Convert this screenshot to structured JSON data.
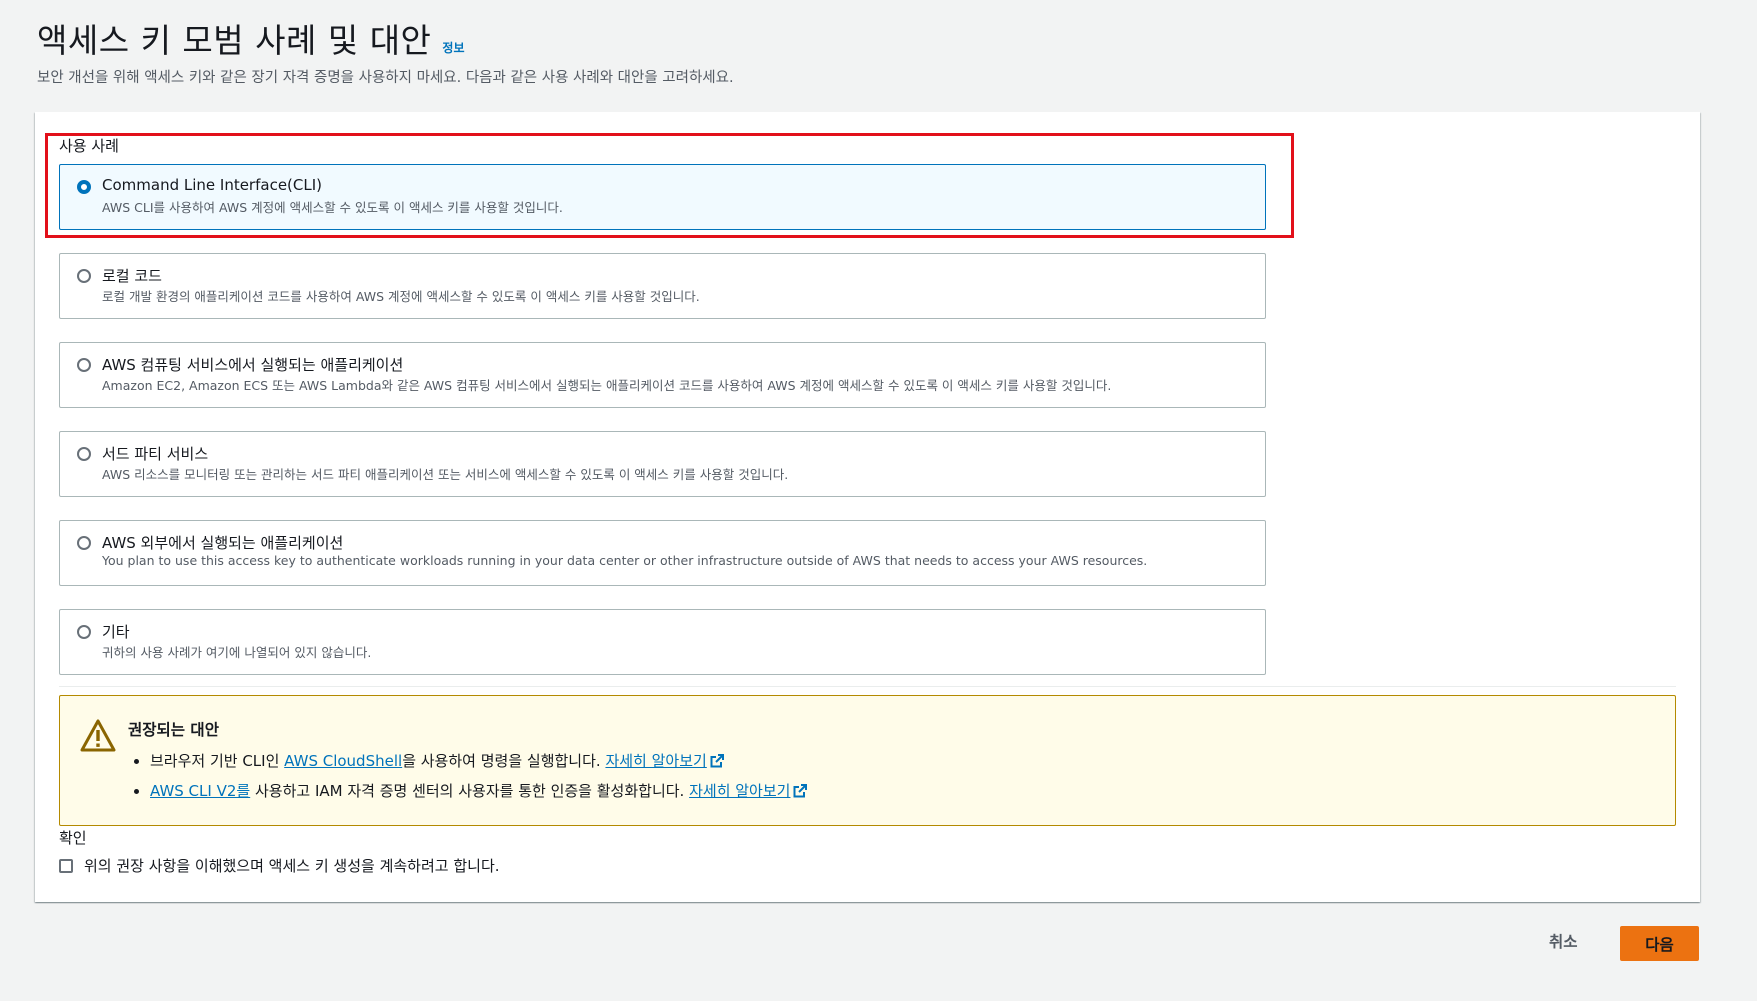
{
  "header": {
    "title": "액세스 키 모범 사례 및 대안",
    "info_link": "정보",
    "description": "보안 개선을 위해 액세스 키와 같은 장기 자격 증명을 사용하지 마세요. 다음과 같은 사용 사례와 대안을 고려하세요."
  },
  "use_case": {
    "label": "사용 사례",
    "selected_index": 0,
    "options": [
      {
        "title": "Command Line Interface(CLI)",
        "description": "AWS CLI를 사용하여 AWS 계정에 액세스할 수 있도록 이 액세스 키를 사용할 것입니다."
      },
      {
        "title": "로컬 코드",
        "description": "로컬 개발 환경의 애플리케이션 코드를 사용하여 AWS 계정에 액세스할 수 있도록 이 액세스 키를 사용할 것입니다."
      },
      {
        "title": "AWS 컴퓨팅 서비스에서 실행되는 애플리케이션",
        "description": "Amazon EC2, Amazon ECS 또는 AWS Lambda와 같은 AWS 컴퓨팅 서비스에서 실행되는 애플리케이션 코드를 사용하여 AWS 계정에 액세스할 수 있도록 이 액세스 키를 사용할 것입니다."
      },
      {
        "title": "서드 파티 서비스",
        "description": "AWS 리소스를 모니터링 또는 관리하는 서드 파티 애플리케이션 또는 서비스에 액세스할 수 있도록 이 액세스 키를 사용할 것입니다."
      },
      {
        "title": "AWS 외부에서 실행되는 애플리케이션",
        "description": "You plan to use this access key to authenticate workloads running in your data center or other infrastructure outside of AWS that needs to access your AWS resources."
      },
      {
        "title": "기타",
        "description": "귀하의 사용 사례가 여기에 나열되어 있지 않습니다."
      }
    ]
  },
  "alert": {
    "title": "권장되는 대안",
    "item1": {
      "before": "브라우저 기반 CLI인 ",
      "link": "AWS CloudShell",
      "after": "을 사용하여 명령을 실행합니다. ",
      "learn_more": "자세히 알아보기"
    },
    "item2": {
      "link": "AWS CLI V2를",
      "after": " 사용하고 IAM 자격 증명 센터의 사용자를 통한 인증을 활성화합니다. ",
      "learn_more": "자세히 알아보기"
    }
  },
  "confirm": {
    "label": "확인",
    "checkbox_text": "위의 권장 사항을 이해했으며 액세스 키 생성을 계속하려고 합니다.",
    "checked": false
  },
  "footer": {
    "cancel": "취소",
    "next": "다음"
  },
  "colors": {
    "primary": "#0073bb",
    "accent_orange": "#ec7211",
    "warning_border": "#b48a00",
    "highlight_red": "#e2101a"
  },
  "icons": [
    "warning-icon",
    "external-link-icon"
  ]
}
